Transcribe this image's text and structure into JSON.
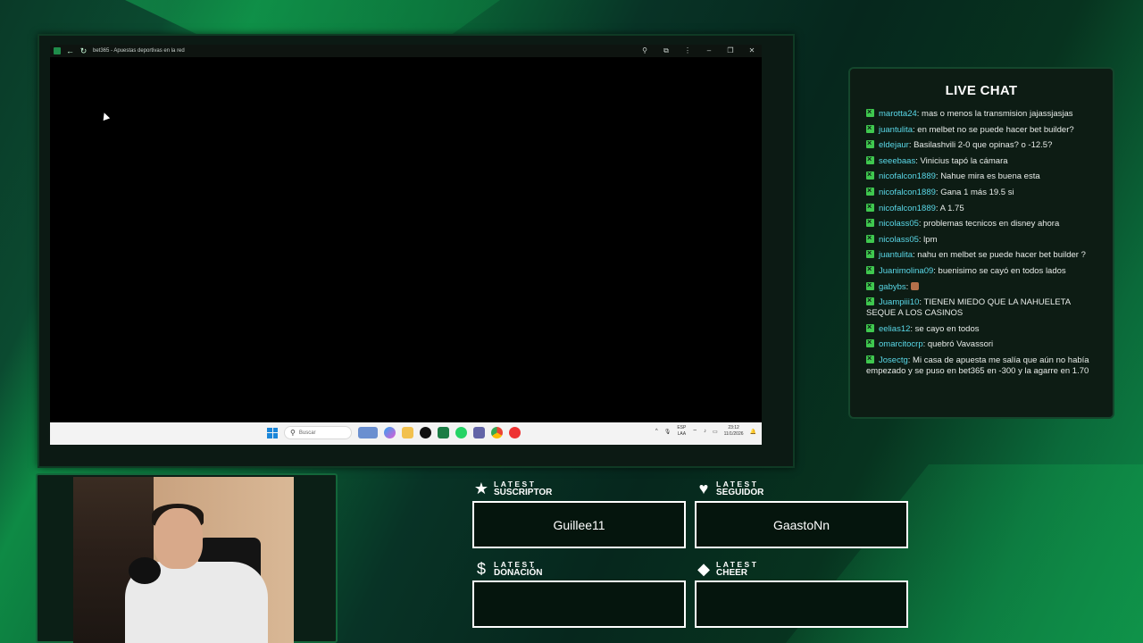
{
  "browser": {
    "tab_title": "bet365 - Apuestas deportivas en la red",
    "back_icon": "back-arrow-icon",
    "reload_icon": "reload-icon"
  },
  "taskbar": {
    "search_placeholder": "Buscar",
    "lang_top": "ESP",
    "lang_bottom": "LAA",
    "time": "23:12",
    "date": "11/1/2026"
  },
  "chat": {
    "title": "LIVE CHAT",
    "messages": [
      {
        "user": "marotta24",
        "text": ": mas o menos la transmision jajassjasjas"
      },
      {
        "user": "juantulita",
        "text": ": en melbet no se puede hacer bet builder?"
      },
      {
        "user": "eldejaur",
        "text": ": Basilashvili 2-0 que opinas? o -12.5?"
      },
      {
        "user": "seeebaas",
        "text": ": Vinicius tapó la cámara"
      },
      {
        "user": "nicofalcon1889",
        "text": ": Nahue mira es buena esta"
      },
      {
        "user": "nicofalcon1889",
        "text": ": Gana 1 más 19.5 si"
      },
      {
        "user": "nicofalcon1889",
        "text": ": A 1.75"
      },
      {
        "user": "nicolass05",
        "text": ": problemas tecnicos en disney ahora"
      },
      {
        "user": "nicolass05",
        "text": ": lpm"
      },
      {
        "user": "juantulita",
        "text": ": nahu en melbet se puede hacer bet builder ?"
      },
      {
        "user": "Juanimolina09",
        "text": ": buenisimo se cayó en todos lados"
      },
      {
        "user": "gabybs",
        "text": ": "
      },
      {
        "user": "Juampiii10",
        "text": ": TIENEN MIEDO QUE LA NAHUELETA SEQUE A LOS CASINOS"
      },
      {
        "user": "eelias12",
        "text": ": se cayo en todos"
      },
      {
        "user": "omarcitocrp",
        "text": ": quebró Vavassori"
      },
      {
        "user": "Josectg",
        "text": ": Mi casa de apuesta me salía que aún no había empezado y se puso en bet365 en -300 y la agarre en 1.70"
      }
    ]
  },
  "latest": {
    "sub": {
      "small": "LATEST",
      "big": "SUSCRIPTOR",
      "value": "Guillee11",
      "icon": "star-icon"
    },
    "follow": {
      "small": "LATEST",
      "big": "SEGUIDOR",
      "value": "GaastoNn",
      "icon": "heart-icon"
    },
    "donation": {
      "small": "LATEST",
      "big": "DONACIÓN",
      "value": "",
      "icon": "dollar-icon"
    },
    "cheer": {
      "small": "LATEST",
      "big": "CHEER",
      "value": "",
      "icon": "diamond-icon"
    }
  }
}
